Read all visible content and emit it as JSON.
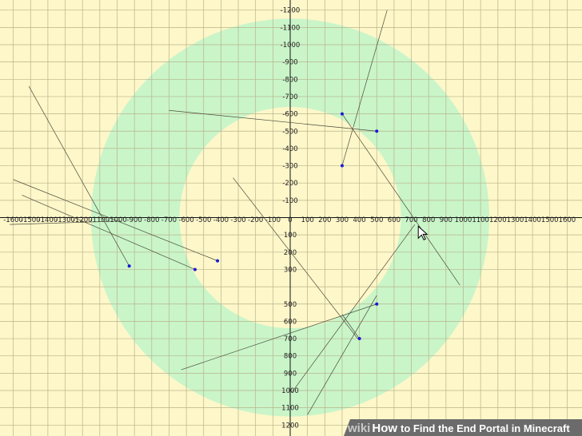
{
  "chart_data": {
    "type": "scatter",
    "title": "",
    "xlabel": "",
    "ylabel": "",
    "xlim": [
      -1650,
      1650
    ],
    "ylim": [
      -1250,
      1250
    ],
    "x_ticks": [
      -1600,
      -1500,
      -1400,
      -1300,
      -1200,
      -1100,
      -1000,
      -900,
      -800,
      -700,
      -600,
      -500,
      -400,
      -300,
      -200,
      -100,
      0,
      100,
      200,
      300,
      400,
      500,
      600,
      700,
      800,
      900,
      1000,
      1100,
      1200,
      1300,
      1400,
      1500,
      1600
    ],
    "y_ticks": [
      -1200,
      -1100,
      -1000,
      -900,
      -800,
      -700,
      -600,
      -500,
      -400,
      -300,
      -200,
      -100,
      100,
      200,
      300,
      500,
      600,
      700,
      800,
      900,
      1000,
      1100,
      1200
    ],
    "grid": true,
    "ring": {
      "inner_radius": 640,
      "outer_radius": 1150
    },
    "points": [
      {
        "x": -930,
        "y": 280
      },
      {
        "x": -550,
        "y": 300
      },
      {
        "x": -420,
        "y": 250
      },
      {
        "x": 300,
        "y": -600
      },
      {
        "x": 500,
        "y": -500
      },
      {
        "x": 300,
        "y": -300
      },
      {
        "x": 500,
        "y": 500
      },
      {
        "x": 400,
        "y": 700
      }
    ],
    "lines": [
      {
        "x1": -1600,
        "y1": -220,
        "x2": -420,
        "y2": 250
      },
      {
        "x1": -1550,
        "y1": -130,
        "x2": -550,
        "y2": 300
      },
      {
        "x1": -1620,
        "y1": 40,
        "x2": -980,
        "y2": 20
      },
      {
        "x1": -1510,
        "y1": -760,
        "x2": -930,
        "y2": 280
      },
      {
        "x1": -700,
        "y1": -620,
        "x2": 500,
        "y2": -500
      },
      {
        "x1": 300,
        "y1": -600,
        "x2": 980,
        "y2": 390
      },
      {
        "x1": 300,
        "y1": -300,
        "x2": 560,
        "y2": -1200
      },
      {
        "x1": -330,
        "y1": -230,
        "x2": 390,
        "y2": 700
      },
      {
        "x1": -630,
        "y1": 880,
        "x2": 500,
        "y2": 500
      },
      {
        "x1": 10,
        "y1": 1010,
        "x2": 720,
        "y2": 40
      },
      {
        "x1": 100,
        "y1": 1140,
        "x2": 500,
        "y2": 450
      },
      {
        "x1": 300,
        "y1": 560,
        "x2": 400,
        "y2": 700
      }
    ],
    "cursor": {
      "x": 740,
      "y": 50
    }
  },
  "colors": {
    "background": "#fdf7c9",
    "grid": "#b9b38a",
    "ring": "#c9f5c9",
    "axis": "#111111",
    "line": "#4a4a3a",
    "point": "#1a1ad6",
    "banner": "#6b6b6b"
  },
  "watermark": {
    "wiki": "wiki",
    "how": "How",
    "rest": "to Find the End Portal in Minecraft"
  }
}
